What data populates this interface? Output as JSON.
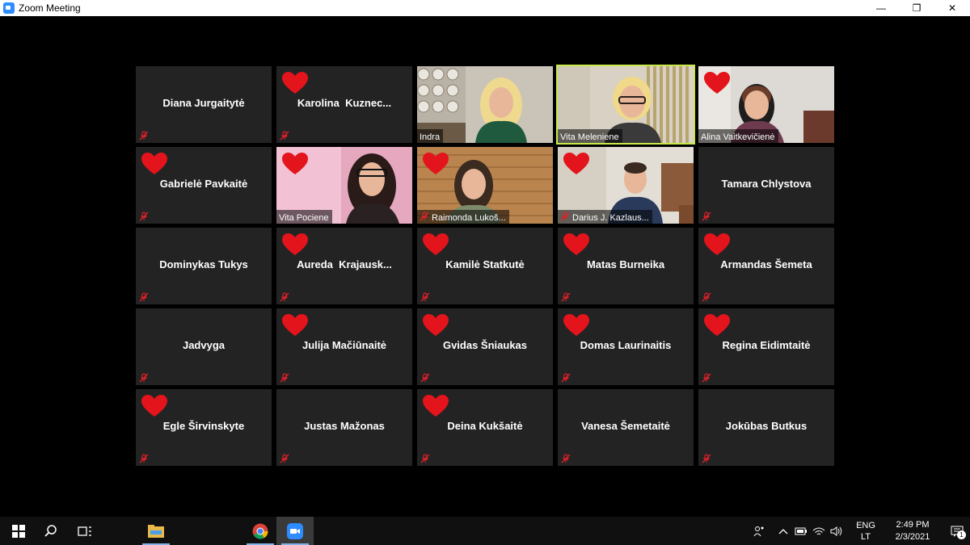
{
  "window": {
    "title": "Zoom Meeting",
    "minimize": "—",
    "restore": "❐",
    "close": "✕"
  },
  "participants": [
    {
      "name": "Diana Jurgaitytė",
      "heart": false,
      "video": false
    },
    {
      "name": "Karolina  Kuznec...",
      "heart": true,
      "video": false
    },
    {
      "name": "Indra",
      "heart": false,
      "video": true,
      "scene": "plates"
    },
    {
      "name": "Vita Meleniene",
      "heart": false,
      "video": true,
      "scene": "office",
      "active": true
    },
    {
      "name": "Alina Vaitkevičienė",
      "heart": true,
      "video": true,
      "scene": "room"
    },
    {
      "name": "Gabrielė Pavkaitė",
      "heart": true,
      "video": false
    },
    {
      "name": "Vita Pociene",
      "heart": true,
      "video": true,
      "scene": "pink"
    },
    {
      "name": "Raimonda Lukoš...",
      "heart": true,
      "video": true,
      "scene": "wood",
      "muted": true
    },
    {
      "name": "Darius J. Kazlaus...",
      "heart": true,
      "video": true,
      "scene": "desk",
      "muted": true
    },
    {
      "name": "Tamara Chlystova",
      "heart": false,
      "video": false
    },
    {
      "name": "Dominykas Tukys",
      "heart": false,
      "video": false
    },
    {
      "name": "Aureda  Krajausk...",
      "heart": true,
      "video": false
    },
    {
      "name": "Kamilė Statkutė",
      "heart": true,
      "video": false
    },
    {
      "name": "Matas Burneika",
      "heart": true,
      "video": false
    },
    {
      "name": "Armandas Šemeta",
      "heart": true,
      "video": false
    },
    {
      "name": "Jadvyga",
      "heart": false,
      "video": false
    },
    {
      "name": "Julija Mačiūnaitė",
      "heart": true,
      "video": false
    },
    {
      "name": "Gvidas Šniaukas",
      "heart": true,
      "video": false
    },
    {
      "name": "Domas Laurinaitis",
      "heart": true,
      "video": false
    },
    {
      "name": "Regina Eidimtaitė",
      "heart": true,
      "video": false
    },
    {
      "name": "Egle Širvinskyte",
      "heart": true,
      "video": false
    },
    {
      "name": "Justas Mažonas",
      "heart": false,
      "video": false
    },
    {
      "name": "Deina Kukšaitė",
      "heart": true,
      "video": false
    },
    {
      "name": "Vanesa Šemetaitė",
      "heart": false,
      "video": false
    },
    {
      "name": "Jokūbas Butkus",
      "heart": false,
      "video": false
    }
  ],
  "taskbar": {
    "items": [
      "start-icon",
      "search-icon",
      "task-view-icon",
      "file-explorer-icon",
      "chrome-icon",
      "zoom-icon"
    ],
    "lang_top": "ENG",
    "lang_bottom": "LT",
    "time": "2:49 PM",
    "date": "2/3/2021",
    "notification_count": "1"
  },
  "colors": {
    "tile_bg": "#232323",
    "active_outline": "#c8e84a",
    "heart": "#e3141b",
    "mute": "#e0202a",
    "taskbar": "#101010"
  }
}
